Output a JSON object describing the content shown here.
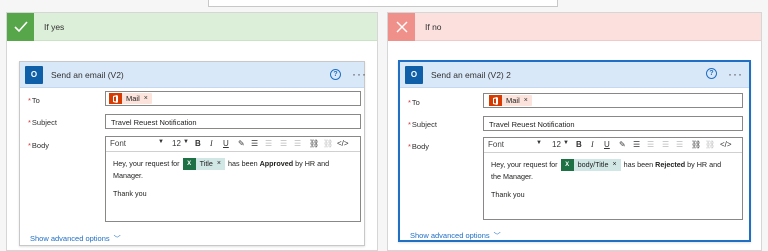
{
  "yes_branch": {
    "title": "If yes",
    "action": {
      "title": "Send an email (V2)",
      "to_label": "To",
      "to_token": "Mail",
      "subject_label": "Subject",
      "subject_value": "Travel Reuest Notification",
      "body_label": "Body",
      "font": "Font",
      "font_size": "12",
      "body_text_1": "Hey, your request for",
      "body_token": "Title",
      "body_text_2": "has been",
      "body_status": "Approved",
      "body_text_3": "by HR and",
      "body_text_4": "Manager.",
      "body_closing": "Thank you",
      "advanced": "Show advanced options"
    }
  },
  "no_branch": {
    "title": "If no",
    "action": {
      "title": "Send an email (V2) 2",
      "to_label": "To",
      "to_token": "Mail",
      "subject_label": "Subject",
      "subject_value": "Travel Reuest Notification",
      "body_label": "Body",
      "font": "Font",
      "font_size": "12",
      "body_text_1": "Hey, your request for",
      "body_token": "body/Title",
      "body_text_2": "has been",
      "body_status": "Rejected",
      "body_text_3": "by HR and",
      "body_text_4": "the Manager.",
      "body_closing": "Thank you",
      "advanced": "Show advanced options"
    }
  },
  "icons": {
    "help": "?",
    "more": "···",
    "close": "×",
    "bold": "B",
    "italic": "I",
    "underline": "U",
    "code": "</>"
  },
  "colors": {
    "yes_accent": "#57a64a",
    "no_accent": "#f0908a",
    "selected_border": "#1f6fc5"
  }
}
